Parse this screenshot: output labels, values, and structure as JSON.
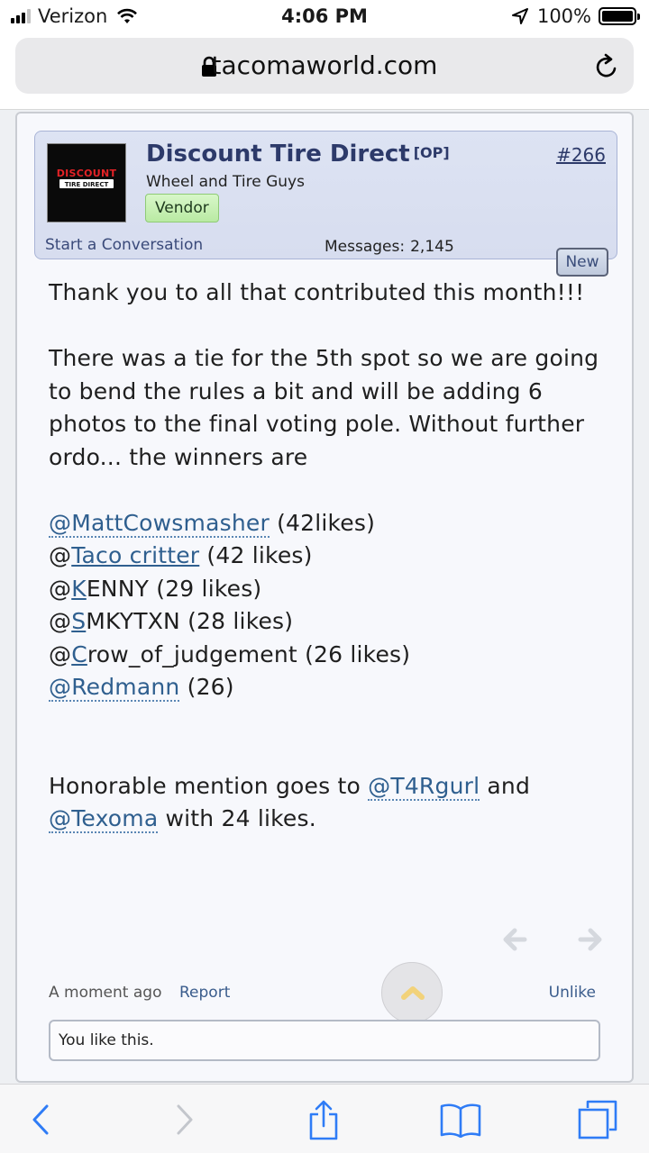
{
  "status_bar": {
    "carrier": "Verizon",
    "time": "4:06 PM",
    "battery": "100%"
  },
  "browser": {
    "url": "tacomaworld.com"
  },
  "post": {
    "author_name": "Discount Tire Direct",
    "op_tag": "[OP]",
    "post_number": "#266",
    "user_title": "Wheel and Tire Guys",
    "badge": "Vendor",
    "start_conversation": "Start a Conversation",
    "messages_label": "Messages:",
    "messages_count": "2,145",
    "new_badge": "New",
    "avatar_logo_text": "DISCOUNT TIRE DIRECT",
    "body": {
      "para1": "Thank you to all that contributed this month!!!",
      "para2": "There was a tie for the 5th spot so we are going to bend the rules a bit and will be adding 6 photos to the final voting pole. Without further ordo... the winners are",
      "winners": [
        {
          "mention": "@MattCowsmasher",
          "suffix": " (42likes)"
        },
        {
          "prefix": "@",
          "link": "Taco critter",
          "suffix": " (42 likes)"
        },
        {
          "prefix": "@",
          "link": "K",
          "rest": "ENNY",
          "suffix": " (29 likes)"
        },
        {
          "prefix": "@",
          "link": "S",
          "rest": "MKYTXN",
          "suffix": " (28 likes)"
        },
        {
          "prefix": "@",
          "link": "C",
          "rest": "row_of_judgement",
          "suffix": " (26 likes)"
        },
        {
          "mention": "@Redmann",
          "suffix": " (26)"
        }
      ],
      "honorable_pre": "Honorable mention goes to ",
      "honorable_mention1": "@T4Rgurl",
      "honorable_mid": " and",
      "honorable_mention2": "@Texoma",
      "honorable_post": " with 24 likes."
    },
    "footer": {
      "time": "A moment ago",
      "report": "Report",
      "unlike": "Unlike",
      "likes_text": "You like this."
    }
  },
  "icons": {
    "lock": "lock-icon",
    "reload": "reload-icon",
    "back": "chevron-left-icon",
    "forward": "chevron-right-icon",
    "share": "share-icon",
    "bookmarks": "book-icon",
    "tabs": "tabs-icon",
    "scroll_top": "chevron-up-icon"
  },
  "colors": {
    "link": "#2f5f8f",
    "username": "#2d3a6a",
    "ios_blue": "#2f7cf6",
    "vendor_green": "#b9eaa3"
  }
}
